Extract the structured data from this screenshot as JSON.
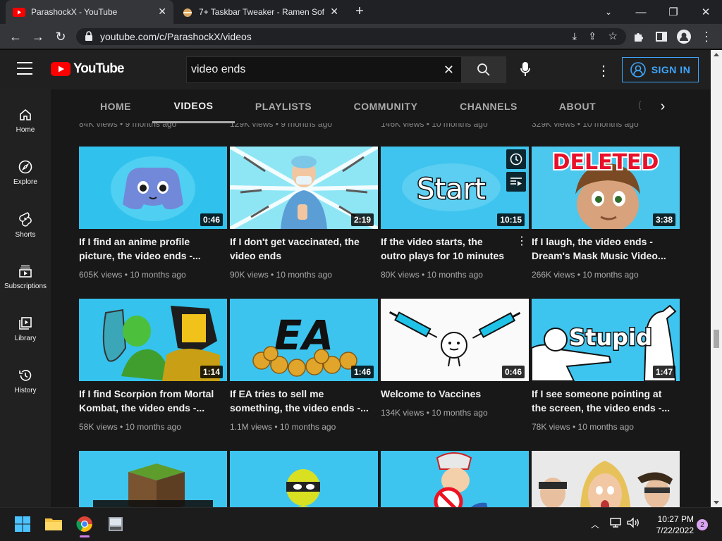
{
  "browser": {
    "tabs": [
      {
        "title": "ParashockX - YouTube",
        "active": true
      },
      {
        "title": "7+ Taskbar Tweaker - Ramen Sof",
        "active": false
      }
    ],
    "new_tab": "+",
    "url": "youtube.com/c/ParashockX/videos"
  },
  "youtube": {
    "logo_text": "YouTube",
    "search_value": "video ends",
    "signin_label": "SIGN IN",
    "sidebar": [
      {
        "label": "Home",
        "icon": "home-icon"
      },
      {
        "label": "Explore",
        "icon": "compass-icon"
      },
      {
        "label": "Shorts",
        "icon": "shorts-icon"
      },
      {
        "label": "Subscriptions",
        "icon": "subscriptions-icon"
      },
      {
        "label": "Library",
        "icon": "library-icon"
      },
      {
        "label": "History",
        "icon": "history-icon"
      }
    ],
    "channel_tabs": [
      "HOME",
      "VIDEOS",
      "PLAYLISTS",
      "COMMUNITY",
      "CHANNELS",
      "ABOUT"
    ],
    "active_tab": "VIDEOS",
    "prev_row_meta": [
      "84K views • 9 months ago",
      "129K views • 9 months ago",
      "146K views • 10 months ago",
      "329K views • 10 months ago"
    ],
    "videos": [
      {
        "title": "If I find an anime profile picture, the video ends -...",
        "meta": "605K views • 10 months ago",
        "duration": "0:46"
      },
      {
        "title": "If I don't get vaccinated, the video ends",
        "meta": "90K views • 10 months ago",
        "duration": "2:19"
      },
      {
        "title": "If the video starts, the outro plays for 10 minutes",
        "meta": "80K views • 10 months ago",
        "duration": "10:15",
        "thumb_text": "Start"
      },
      {
        "title": "If I laugh, the video ends - Dream's Mask Music Video...",
        "meta": "266K views • 10 months ago",
        "duration": "3:38",
        "thumb_text": "DELETED"
      },
      {
        "title": "If I find Scorpion from Mortal Kombat, the video ends -...",
        "meta": "58K views • 10 months ago",
        "duration": "1:14"
      },
      {
        "title": "If EA tries to sell me something, the video ends -...",
        "meta": "1.1M views • 10 months ago",
        "duration": "1:46",
        "thumb_text": "EA"
      },
      {
        "title": "Welcome to Vaccines",
        "meta": "134K views • 10 months ago",
        "duration": "0:46"
      },
      {
        "title": "If I see someone pointing at the screen, the video ends -...",
        "meta": "78K views • 10 months ago",
        "duration": "1:47",
        "thumb_text": "Stupid"
      }
    ]
  },
  "taskbar": {
    "time": "10:27 PM",
    "date": "7/22/2022",
    "notification_count": "2"
  }
}
